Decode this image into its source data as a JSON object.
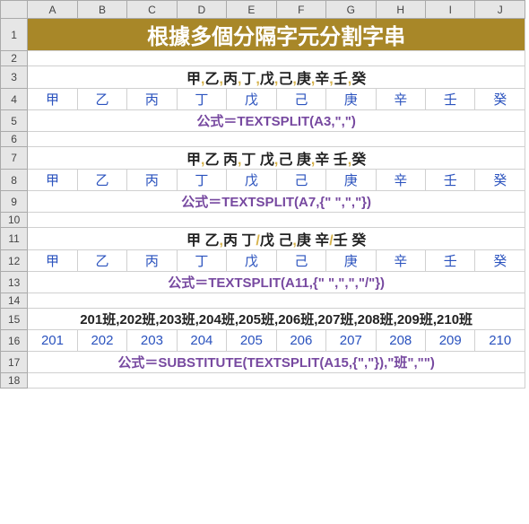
{
  "columns": [
    "A",
    "B",
    "C",
    "D",
    "E",
    "F",
    "G",
    "H",
    "I",
    "J"
  ],
  "rows": [
    "1",
    "2",
    "3",
    "4",
    "5",
    "6",
    "7",
    "8",
    "9",
    "10",
    "11",
    "12",
    "13",
    "14",
    "15",
    "16",
    "17",
    "18"
  ],
  "title": "根據多個分隔字元分割字串",
  "ex1": {
    "chars": [
      "甲",
      "乙",
      "丙",
      "丁",
      "戊",
      "己",
      "庚",
      "辛",
      "壬",
      "癸"
    ],
    "seps": [
      ",",
      ",",
      ",",
      ",",
      ",",
      ",",
      ",",
      ",",
      ","
    ],
    "split": [
      "甲",
      "乙",
      "丙",
      "丁",
      "戊",
      "己",
      "庚",
      "辛",
      "壬",
      "癸"
    ],
    "formula": "公式＝TEXTSPLIT(A3,\",\")"
  },
  "ex2": {
    "chars": [
      "甲",
      "乙",
      "丙",
      "丁",
      "戊",
      "己",
      "庚",
      "辛",
      "壬",
      "癸"
    ],
    "seps": [
      ",",
      " ",
      ",",
      " ",
      ",",
      " ",
      ",",
      " ",
      ","
    ],
    "split": [
      "甲",
      "乙",
      "丙",
      "丁",
      "戊",
      "己",
      "庚",
      "辛",
      "壬",
      "癸"
    ],
    "formula": "公式＝TEXTSPLIT(A7,{\" \",\",\"})"
  },
  "ex3": {
    "chars": [
      "甲",
      "乙",
      "丙",
      "丁",
      "戊",
      "己",
      "庚",
      "辛",
      "壬",
      "癸"
    ],
    "seps": [
      " ",
      ",",
      " ",
      "/",
      " ",
      ",",
      " ",
      "/",
      " "
    ],
    "split": [
      "甲",
      "乙",
      "丙",
      "丁",
      "戊",
      "己",
      "庚",
      "辛",
      "壬",
      "癸"
    ],
    "formula": "公式＝TEXTSPLIT(A11,{\" \",\",\",\"/\"})"
  },
  "ex4": {
    "items": [
      "201班",
      "202班",
      "203班",
      "204班",
      "205班",
      "206班",
      "207班",
      "208班",
      "209班",
      "210班"
    ],
    "split": [
      "201",
      "202",
      "203",
      "204",
      "205",
      "206",
      "207",
      "208",
      "209",
      "210"
    ],
    "formula": "公式＝SUBSTITUTE(TEXTSPLIT(A15,{\",\"}),\"班\",\"\")"
  }
}
